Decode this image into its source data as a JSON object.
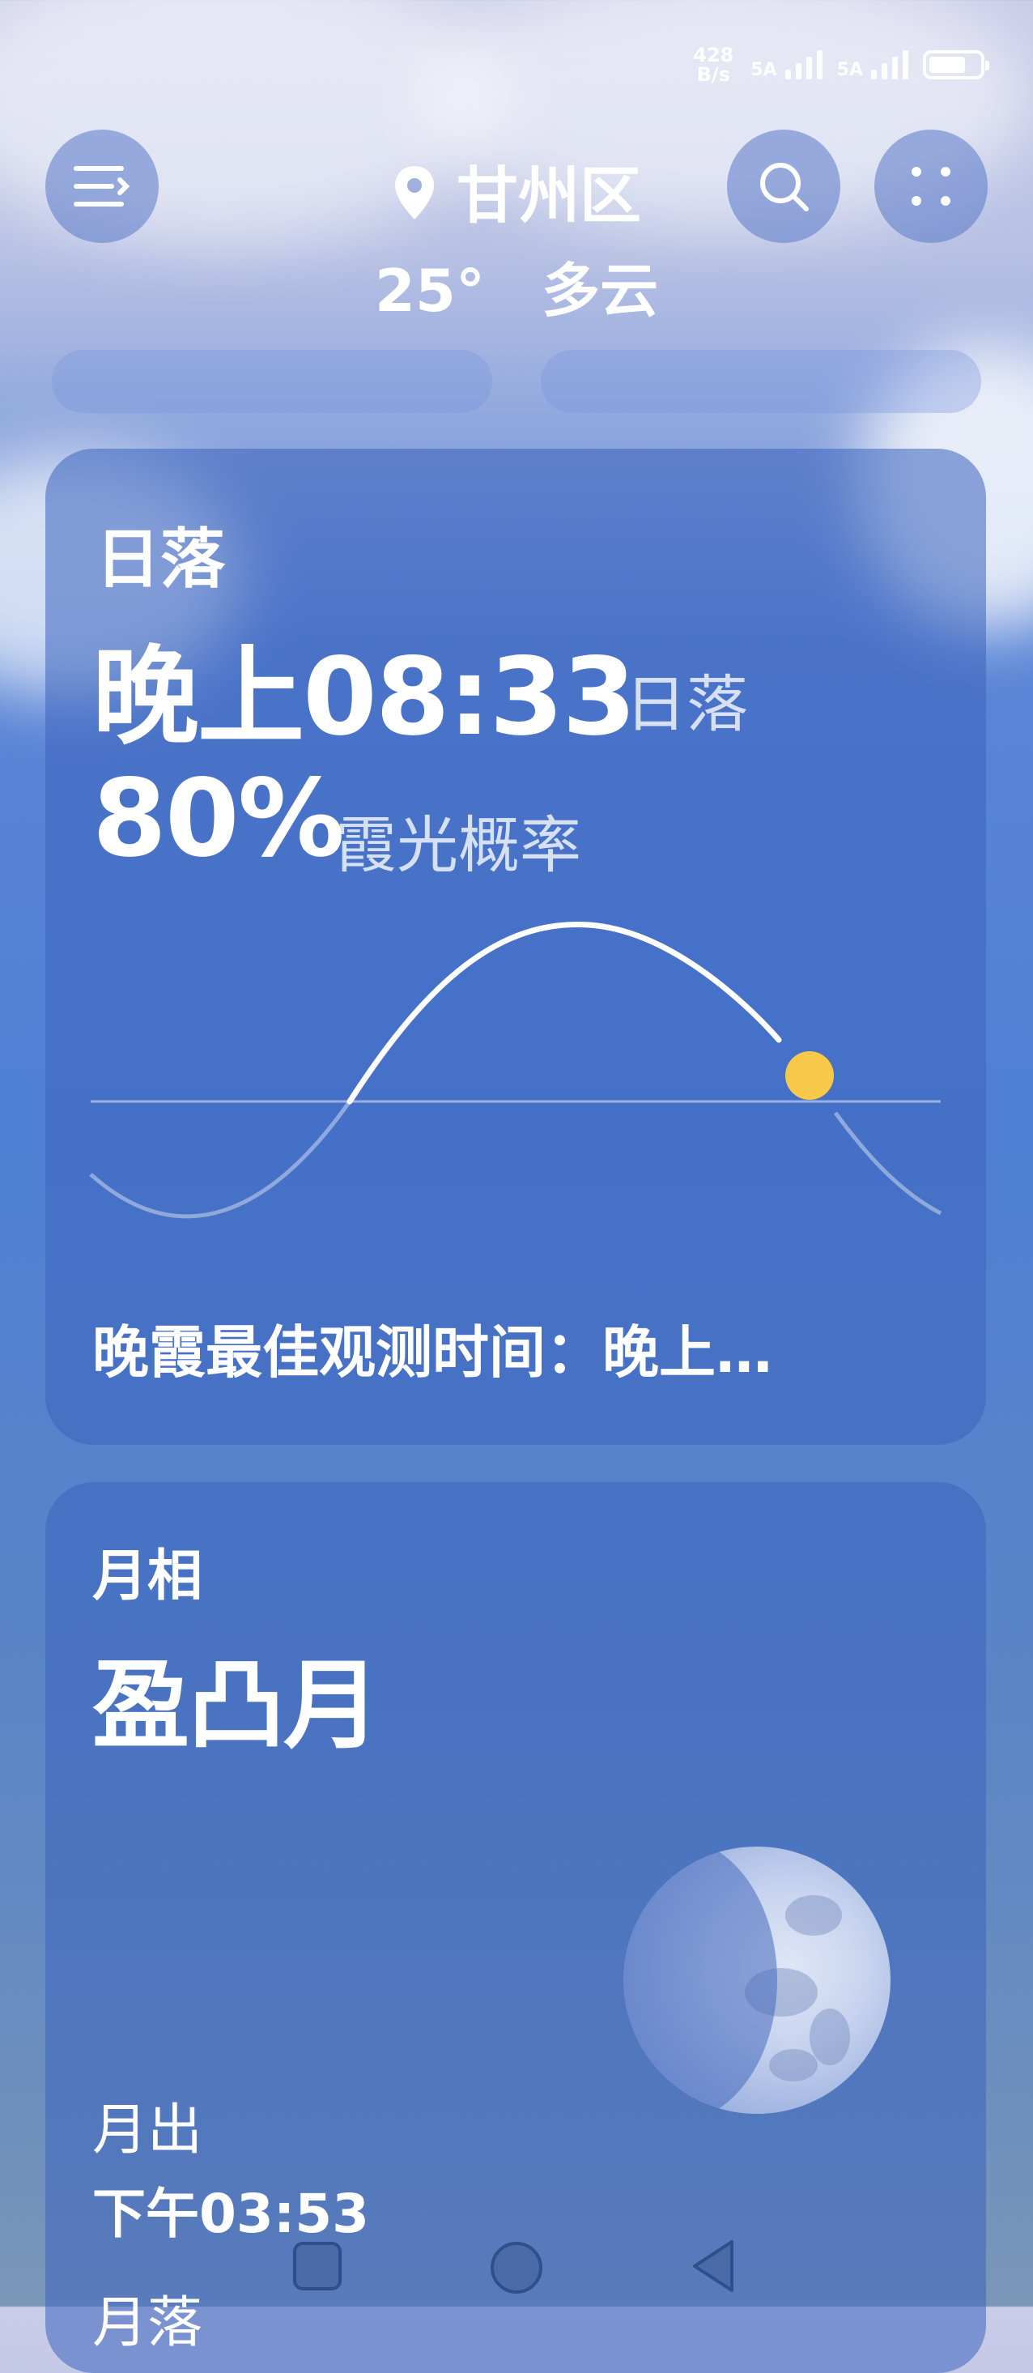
{
  "status_bar": {
    "net_speed_value": "428",
    "net_speed_unit": "B/s",
    "sim1_label": "5A",
    "sim2_label": "5A"
  },
  "header": {
    "location": "甘州区",
    "temperature": "25°",
    "condition": "多云"
  },
  "sunset_card": {
    "title": "日落",
    "time": "晚上08:33",
    "time_label": "日落",
    "probability": "80%",
    "probability_label": "霞光概率",
    "best_view": "晚霞最佳观测时间：晚上…",
    "colors": {
      "sun": "#f7c84a",
      "curve": "#ffffff"
    }
  },
  "moon_card": {
    "title": "月相",
    "phase": "盈凸月",
    "moonrise_label": "月出",
    "moonrise_time": "下午03:53",
    "moonset_label": "月落"
  },
  "icons": [
    "menu-icon",
    "location-pin-icon",
    "search-icon",
    "grid-dots-icon",
    "square-nav-icon",
    "circle-nav-icon",
    "back-triangle-icon"
  ]
}
